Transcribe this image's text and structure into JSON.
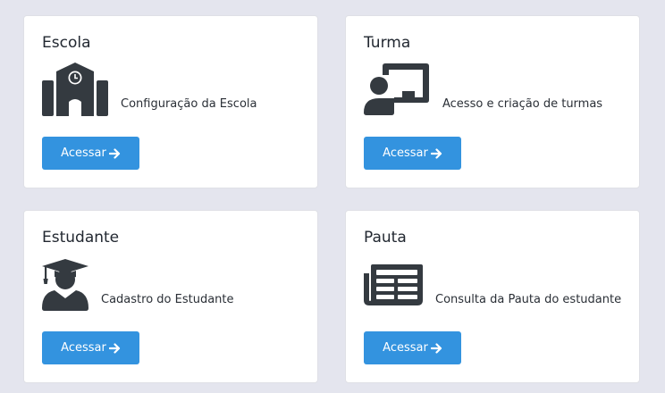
{
  "accent_color": "#3393df",
  "cards": [
    {
      "title": "Escola",
      "description": "Configuração da Escola",
      "button_label": "Acessar",
      "icon": "school-icon"
    },
    {
      "title": "Turma",
      "description": "Acesso e criação de turmas",
      "button_label": "Acessar",
      "icon": "teacher-board-icon"
    },
    {
      "title": "Estudante",
      "description": "Cadastro do Estudante",
      "button_label": "Acessar",
      "icon": "graduate-student-icon"
    },
    {
      "title": "Pauta",
      "description": "Consulta da Pauta do estudante",
      "button_label": "Acessar",
      "icon": "newspaper-icon"
    }
  ]
}
